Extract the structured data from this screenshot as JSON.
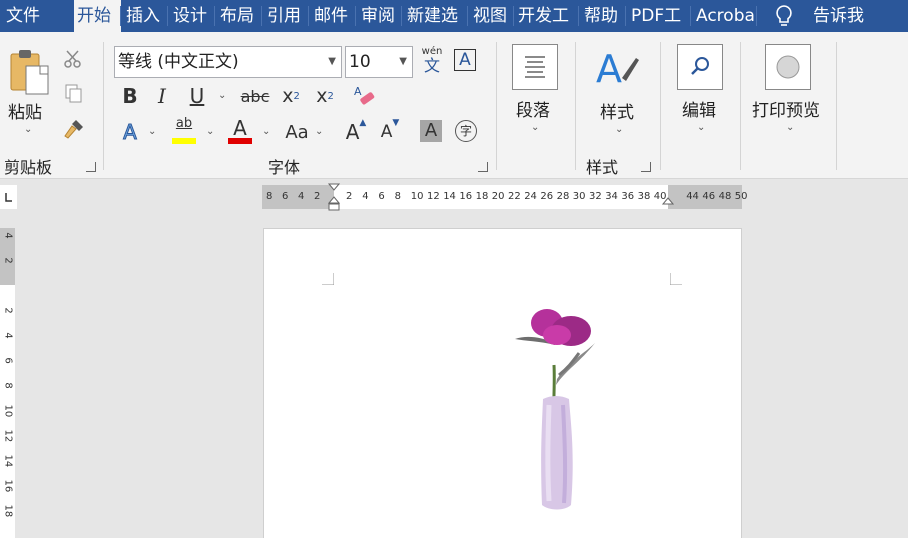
{
  "tabs": [
    {
      "label": "文件",
      "active": false
    },
    {
      "label": "开始",
      "active": true
    },
    {
      "label": "插入",
      "active": false
    },
    {
      "label": "设计",
      "active": false
    },
    {
      "label": "布局",
      "active": false
    },
    {
      "label": "引用",
      "active": false
    },
    {
      "label": "邮件",
      "active": false
    },
    {
      "label": "审阅",
      "active": false
    },
    {
      "label": "新建选",
      "active": false
    },
    {
      "label": "视图",
      "active": false
    },
    {
      "label": "开发工",
      "active": false
    },
    {
      "label": "帮助",
      "active": false
    },
    {
      "label": "PDF工",
      "active": false
    },
    {
      "label": "Acroba",
      "active": false
    }
  ],
  "tell_me": "告诉我",
  "clipboard": {
    "paste_label": "粘贴",
    "group_label": "剪贴板"
  },
  "font": {
    "font_name": "等线 (中文正文)",
    "font_size": "10",
    "phonetic_top": "wén",
    "phonetic_bottom": "文",
    "bold": "B",
    "italic": "I",
    "underline": "U",
    "strike": "abc",
    "subscript": "x",
    "sub_mark": "2",
    "superscript": "x",
    "sup_mark": "2",
    "text_effects": "A",
    "highlight": "ab",
    "font_color": "A",
    "case": "Aa",
    "grow": "A",
    "shrink": "A",
    "shading": "A",
    "enclose": "字",
    "box_char": "A",
    "group_label": "字体"
  },
  "paragraph": {
    "label": "段落"
  },
  "styles": {
    "label": "样式",
    "group_label": "样式"
  },
  "editing": {
    "label": "编辑"
  },
  "print_preview": {
    "label": "打印预览"
  },
  "ruler": {
    "left_numbers": [
      "8",
      "6",
      "4",
      "2"
    ],
    "right_numbers": [
      "2",
      "4",
      "6",
      "8",
      "10",
      "12",
      "14",
      "16",
      "18",
      "20",
      "22",
      "24",
      "26",
      "28",
      "30",
      "32",
      "34",
      "36",
      "38",
      "40",
      "",
      "44",
      "46",
      "48",
      "50"
    ]
  },
  "vruler_numbers": [
    "4",
    "2",
    "",
    "2",
    "4",
    "6",
    "8",
    "10",
    "12",
    "14",
    "16",
    "18"
  ],
  "colors": {
    "ribbon_blue": "#2b579a",
    "highlight_yellow": "#ffff00",
    "font_red": "#e00000",
    "flower": "#b5319b",
    "vase": "#d8c7e6"
  }
}
